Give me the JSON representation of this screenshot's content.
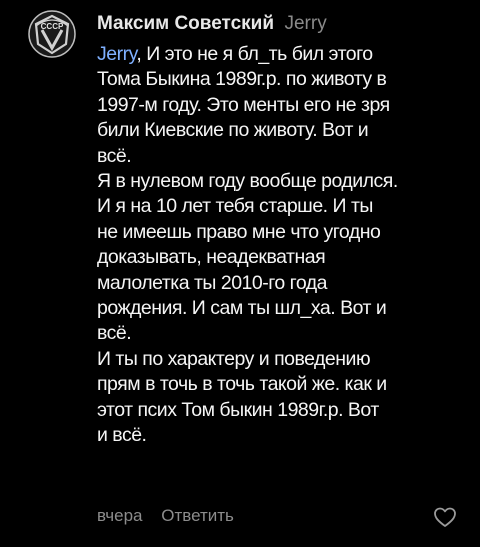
{
  "comment": {
    "author": "Максим Советский",
    "reply_to": "Jerry",
    "mention": "Jerry",
    "first_line_rest": ", И это не я бл_ть бил этого",
    "lines": [
      "Тома Быкина 1989г.р. по животу в",
      "1997-м году. Это менты его не зря",
      "били Киевские по животу. Вот и",
      "всё.",
      "Я в нулевом году вообще родился.",
      "И я на 10 лет тебя старше. И ты",
      "не имеешь право мне что угодно",
      "доказывать, неадекватная",
      "малолетка ты 2010-го года",
      "рождения. И сам ты шл_ха. Вот и",
      "всё.",
      "И ты по характеру и поведению",
      "прям в точь в точь такой же. как и",
      "этот псих Том быкин 1989г.р. Вот",
      "и всё."
    ],
    "timestamp": "вчера",
    "reply_label": "Ответить"
  },
  "avatar": {
    "icon": "ussr-quality-mark-icon",
    "text": "СССР"
  },
  "icons": {
    "like": "heart-outline-icon"
  },
  "colors": {
    "background": "#000000",
    "text": "#f5f5f5",
    "mention": "#7fb0ff",
    "muted": "#8c8c8c"
  }
}
